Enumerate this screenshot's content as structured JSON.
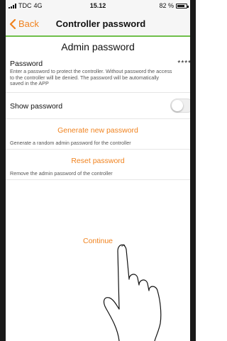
{
  "status_bar": {
    "carrier": "TDC",
    "network": "4G",
    "time": "15.12",
    "battery": "82 %",
    "battery_level": 0.82
  },
  "nav": {
    "back_label": "Back",
    "title": "Controller password"
  },
  "main": {
    "heading": "Admin password",
    "password": {
      "label": "Password",
      "description": "Enter a password to protect the controller. Without password the access to the controller will be denied. The password will be automatically saved in the APP",
      "masked_value": "****"
    },
    "show_password": {
      "label": "Show password",
      "enabled": false
    },
    "generate": {
      "label": "Generate new password",
      "description": "Generate a random admin password for the controller"
    },
    "reset": {
      "label": "Reset password",
      "description": "Remove the admin password of the controller"
    },
    "continue_label": "Continue"
  },
  "colors": {
    "accent": "#f0821e",
    "nav_underline": "#6fbf4a"
  }
}
